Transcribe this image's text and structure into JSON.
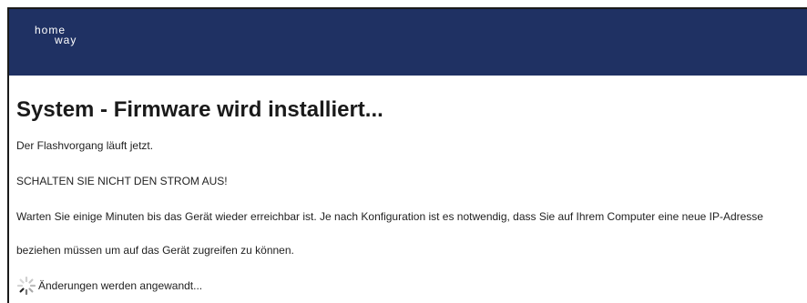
{
  "header": {
    "logo_text_top": "home",
    "logo_text_bottom": "way",
    "background": "#1f3163"
  },
  "main": {
    "title": "System - Firmware wird installiert...",
    "flash_status": "Der Flashvorgang läuft jetzt.",
    "warning": "SCHALTEN SIE NICHT DEN STROM AUS!",
    "instructions_line1": "Warten Sie einige Minuten bis das Gerät wieder erreichbar ist. Je nach Konfiguration ist es notwendig, dass Sie auf Ihrem Computer eine neue IP-Adresse",
    "instructions_line2": "beziehen müssen um auf das Gerät zugreifen zu können.",
    "progress_text": "Änderungen werden angewandt...",
    "progress_icon": "spinner-icon"
  }
}
